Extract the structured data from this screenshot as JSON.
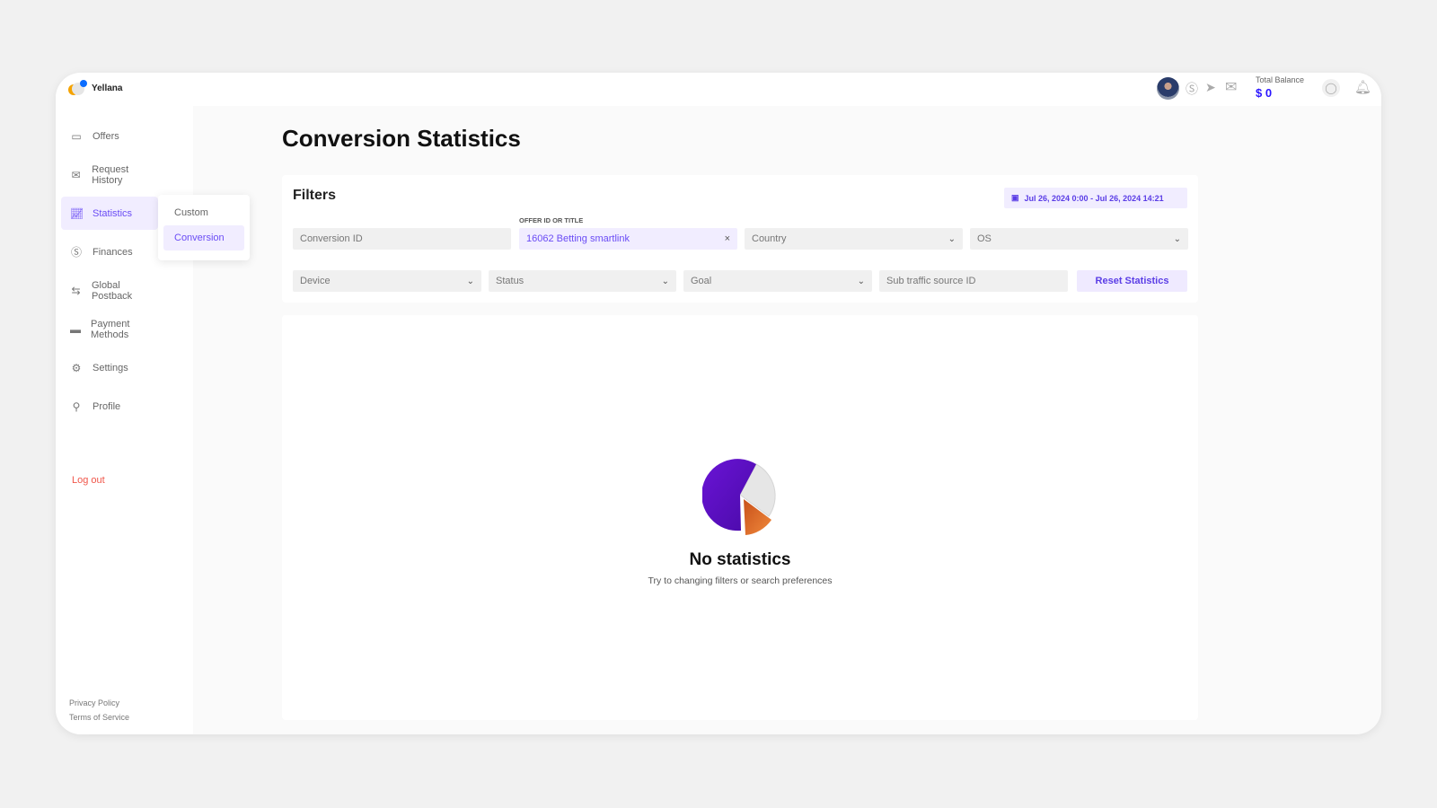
{
  "brand": {
    "name": "Yellana"
  },
  "header": {
    "total_balance_label": "Total Balance",
    "total_balance_value": "$ 0"
  },
  "sidebar": {
    "items": [
      {
        "label": "Offers",
        "icon": "folder-icon"
      },
      {
        "label": "Request History",
        "icon": "mail-icon"
      },
      {
        "label": "Statistics",
        "icon": "chart-icon",
        "active": true
      },
      {
        "label": "Finances",
        "icon": "dollar-icon"
      },
      {
        "label": "Global Postback",
        "icon": "arrows-icon"
      },
      {
        "label": "Payment Methods",
        "icon": "card-icon"
      },
      {
        "label": "Settings",
        "icon": "gear-icon"
      },
      {
        "label": "Profile",
        "icon": "user-icon"
      }
    ],
    "logout": "Log out",
    "privacy": "Privacy Policy",
    "terms": "Terms of Service"
  },
  "submenu": {
    "items": [
      "Custom",
      "Conversion"
    ],
    "selected": "Conversion"
  },
  "page": {
    "title": "Conversion Statistics"
  },
  "filters": {
    "title": "Filters",
    "date_range": "Jul 26, 2024 0:00 - Jul 26, 2024 14:21",
    "conversion_id_placeholder": "Conversion ID",
    "offer_label": "OFFER ID OR TITLE",
    "offer_value": "16062 Betting smartlink",
    "country": "Country",
    "os": "OS",
    "device": "Device",
    "status": "Status",
    "goal": "Goal",
    "sub_source_placeholder": "Sub traffic source ID",
    "reset": "Reset Statistics"
  },
  "empty": {
    "title": "No statistics",
    "subtitle": "Try to changing filters or search preferences"
  },
  "colors": {
    "accent": "#6a4cf5",
    "balance": "#2b16ff",
    "logout": "#f0564a"
  }
}
